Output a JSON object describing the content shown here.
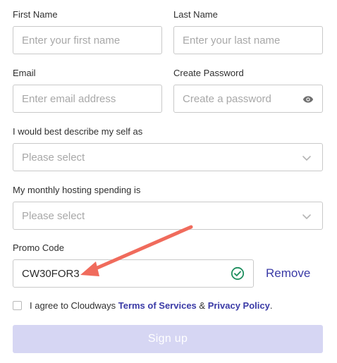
{
  "first_name": {
    "label": "First Name",
    "placeholder": "Enter your first name"
  },
  "last_name": {
    "label": "Last Name",
    "placeholder": "Enter your last name"
  },
  "email": {
    "label": "Email",
    "placeholder": "Enter email address"
  },
  "password": {
    "label": "Create Password",
    "placeholder": "Create a password",
    "icon": "eye-icon"
  },
  "describe": {
    "label": "I would best describe my self as",
    "value": "Please select",
    "icon": "chevron-down-icon"
  },
  "spending": {
    "label": "My monthly hosting spending is",
    "value": "Please select",
    "icon": "chevron-down-icon"
  },
  "promo": {
    "label": "Promo Code",
    "value": "CW30FOR3",
    "icon": "check-circle-icon",
    "remove_label": "Remove"
  },
  "agree": {
    "prefix": "I agree to Cloudways ",
    "terms": "Terms of Services",
    "amp": " & ",
    "privacy": "Privacy Policy",
    "suffix": "."
  },
  "signup_label": "Sign up",
  "colors": {
    "link": "#3a3aa6",
    "success": "#1f8f5f",
    "arrow": "#f06b5c",
    "button_disabled": "#d6d6f3",
    "border": "#c9c9c9"
  }
}
